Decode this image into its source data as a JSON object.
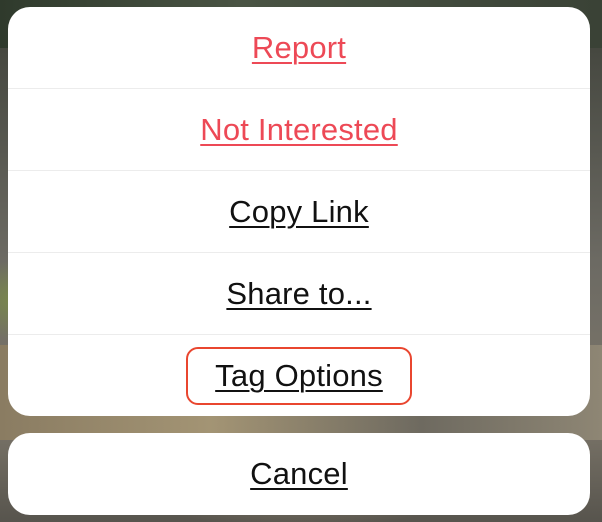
{
  "menu": {
    "items": [
      {
        "label": "Report",
        "style": "destructive",
        "color": "#ed4956"
      },
      {
        "label": "Not Interested",
        "style": "destructive",
        "color": "#ed4956"
      },
      {
        "label": "Copy Link",
        "style": "default",
        "color": "#111111"
      },
      {
        "label": "Share to...",
        "style": "default",
        "color": "#111111"
      },
      {
        "label": "Tag Options",
        "style": "default",
        "color": "#111111",
        "highlighted": true
      }
    ],
    "cancel_label": "Cancel",
    "highlight_color": "#e9462f"
  }
}
